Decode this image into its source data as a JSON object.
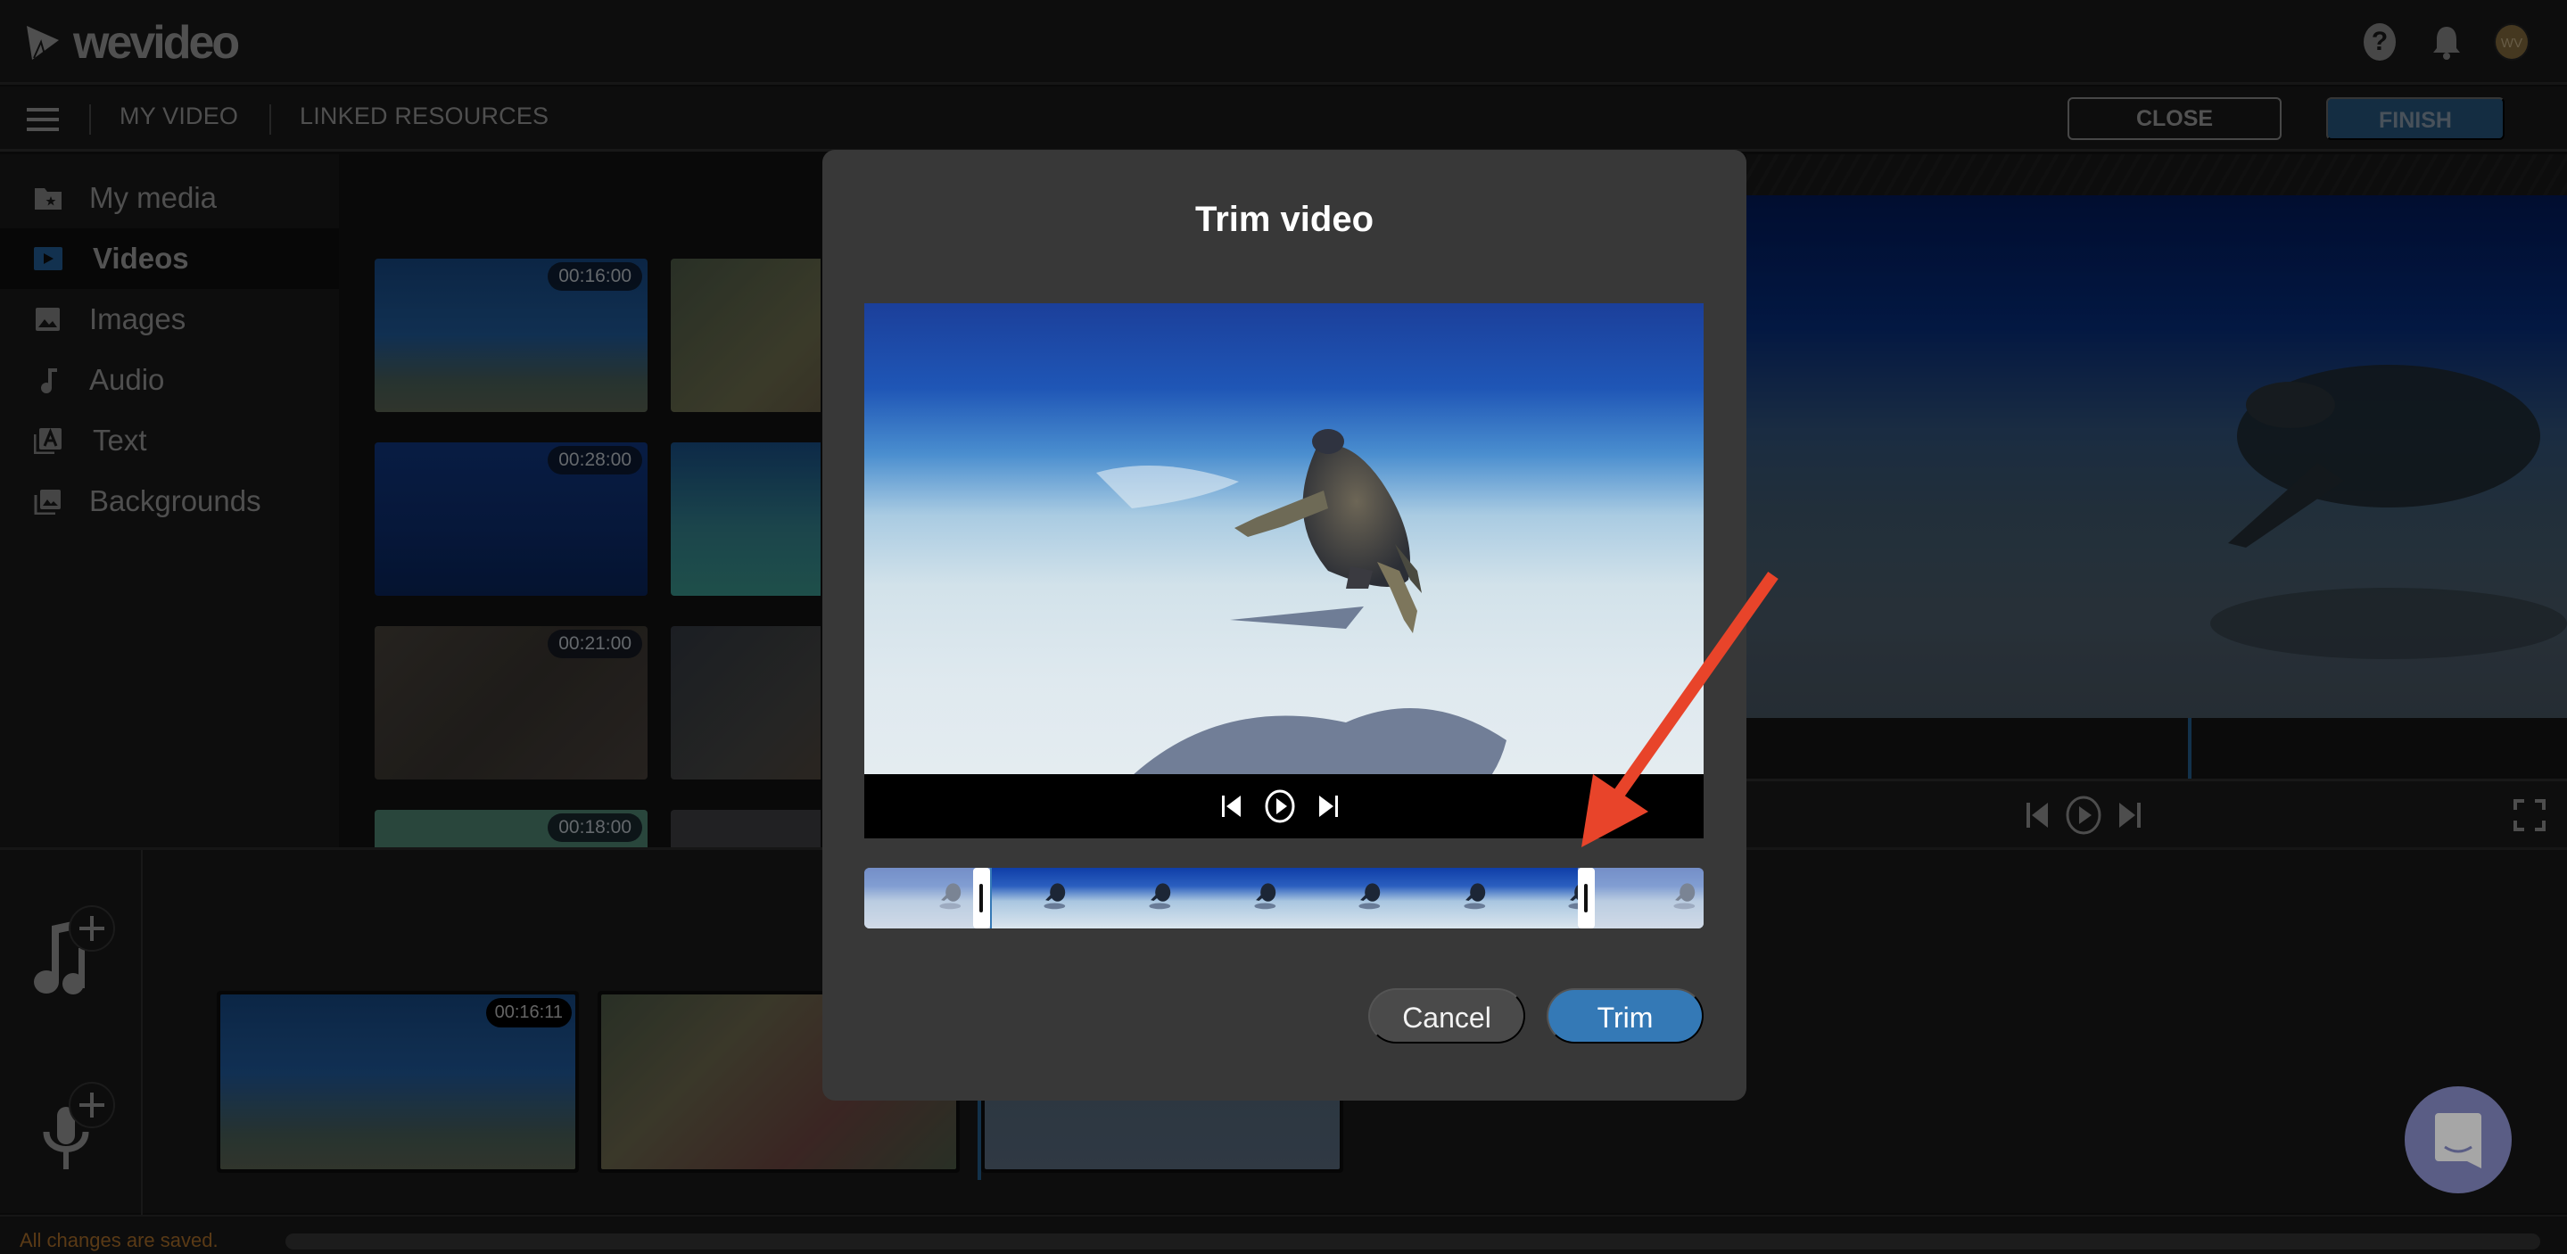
{
  "app": {
    "logo_text": "wevideo",
    "avatar_initials": "WV"
  },
  "nav": {
    "links": [
      "MY VIDEO",
      "LINKED RESOURCES"
    ],
    "close_label": "CLOSE",
    "finish_label": "FINISH"
  },
  "sidebar": {
    "items": [
      {
        "label": "My media",
        "icon": "folder-star-icon",
        "active": false
      },
      {
        "label": "Videos",
        "icon": "video-play-icon",
        "active": true
      },
      {
        "label": "Images",
        "icon": "image-icon",
        "active": false
      },
      {
        "label": "Audio",
        "icon": "music-note-icon",
        "active": false
      },
      {
        "label": "Text",
        "icon": "text-layers-icon",
        "active": false
      },
      {
        "label": "Backgrounds",
        "icon": "background-layers-icon",
        "active": false
      }
    ]
  },
  "media_grid": {
    "items": [
      {
        "duration": "00:16:00",
        "scene": "hawksbill turtle over reef, blue water"
      },
      {
        "duration": "",
        "scene": "turtle resting on coral"
      },
      {
        "duration": "00:28:00",
        "scene": "small turtle in deep blue water"
      },
      {
        "duration": "",
        "scene": "green turtle over teal reef"
      },
      {
        "duration": "00:21:00",
        "scene": "turtle in seagrass"
      },
      {
        "duration": "",
        "scene": "turtle on rocky seabed"
      },
      {
        "duration": "00:18:00",
        "scene": "green water"
      },
      {
        "duration": "",
        "scene": "gray"
      }
    ]
  },
  "timeline": {
    "clips": [
      {
        "duration": "00:16:11",
        "scene": "hawksbill turtle over reef"
      },
      {
        "duration": "",
        "scene": "turtle on coral"
      },
      {
        "duration": "",
        "scene": "turtle over sand"
      }
    ],
    "status_text": "All changes are saved."
  },
  "modal": {
    "title": "Trim video",
    "cancel_label": "Cancel",
    "trim_label": "Trim",
    "trim_selection": {
      "start_fraction": 0.15,
      "end_fraction": 0.85
    },
    "frame_count": 8
  },
  "colors": {
    "accent": "#3479b6",
    "finish_bg": "#1f4666",
    "annotation_arrow": "#e8442a",
    "status_text": "#8a5a22",
    "intercom": "#8b8fcc"
  }
}
